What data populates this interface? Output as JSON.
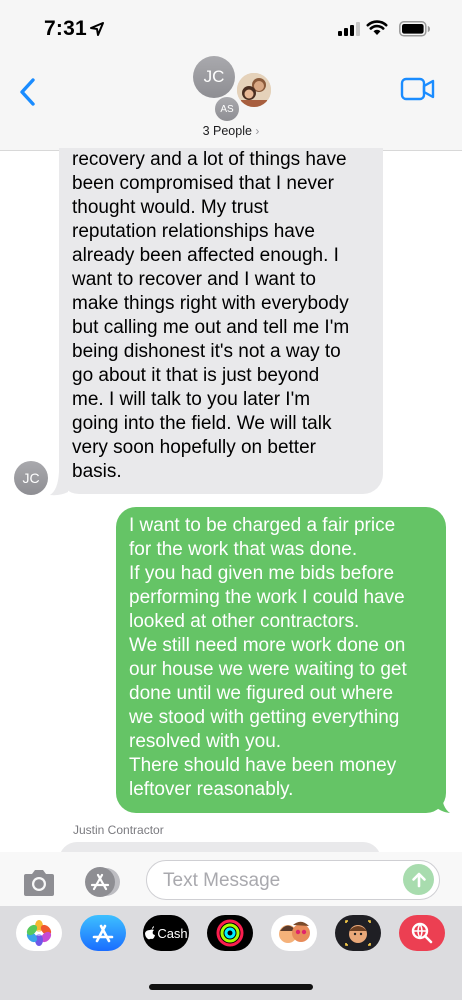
{
  "status_bar": {
    "time": "7:31"
  },
  "header": {
    "avatars": [
      "JC",
      "AS"
    ],
    "people_label": "3 People",
    "chevron": "›"
  },
  "messages": {
    "incoming": {
      "sender_avatar": "JC",
      "lines": [
        "recovery and a lot of things have",
        "been compromised that I never",
        "thought would. My trust",
        "reputation relationships have",
        "already been affected enough. I",
        "want to recover and I want to",
        "make things right with everybody",
        "but calling me out and tell me I'm",
        "being dishonest it's not a way to",
        "go about it that is just beyond",
        "me. I will talk to you later I'm",
        "going into the field. We will talk",
        "very soon hopefully on better",
        "basis."
      ]
    },
    "outgoing": {
      "lines": [
        "I want to be charged a fair price",
        "for the work that was done.",
        "If you had given me bids before",
        "performing the work I could have",
        "looked at other contractors.",
        "We still need more work done on",
        "our house we were waiting to get",
        "done until we figured out where",
        "we stood with getting everything",
        "resolved with you.",
        "There should have been money",
        "leftover reasonably."
      ]
    },
    "next_sender_name": "Justin Contractor"
  },
  "input": {
    "placeholder": "Text Message"
  },
  "app_drawer": {
    "apps": [
      {
        "name": "photos-icon"
      },
      {
        "name": "app-store-icon"
      },
      {
        "name": "apple-cash-icon",
        "label": "Cash"
      },
      {
        "name": "activity-icon"
      },
      {
        "name": "memoji-stickers-icon"
      },
      {
        "name": "memoji-icon"
      },
      {
        "name": "web-search-icon"
      }
    ]
  },
  "colors": {
    "accent_blue": "#1a8cff",
    "outgoing_bubble": "#65c466",
    "incoming_bubble": "#e9e9eb"
  }
}
